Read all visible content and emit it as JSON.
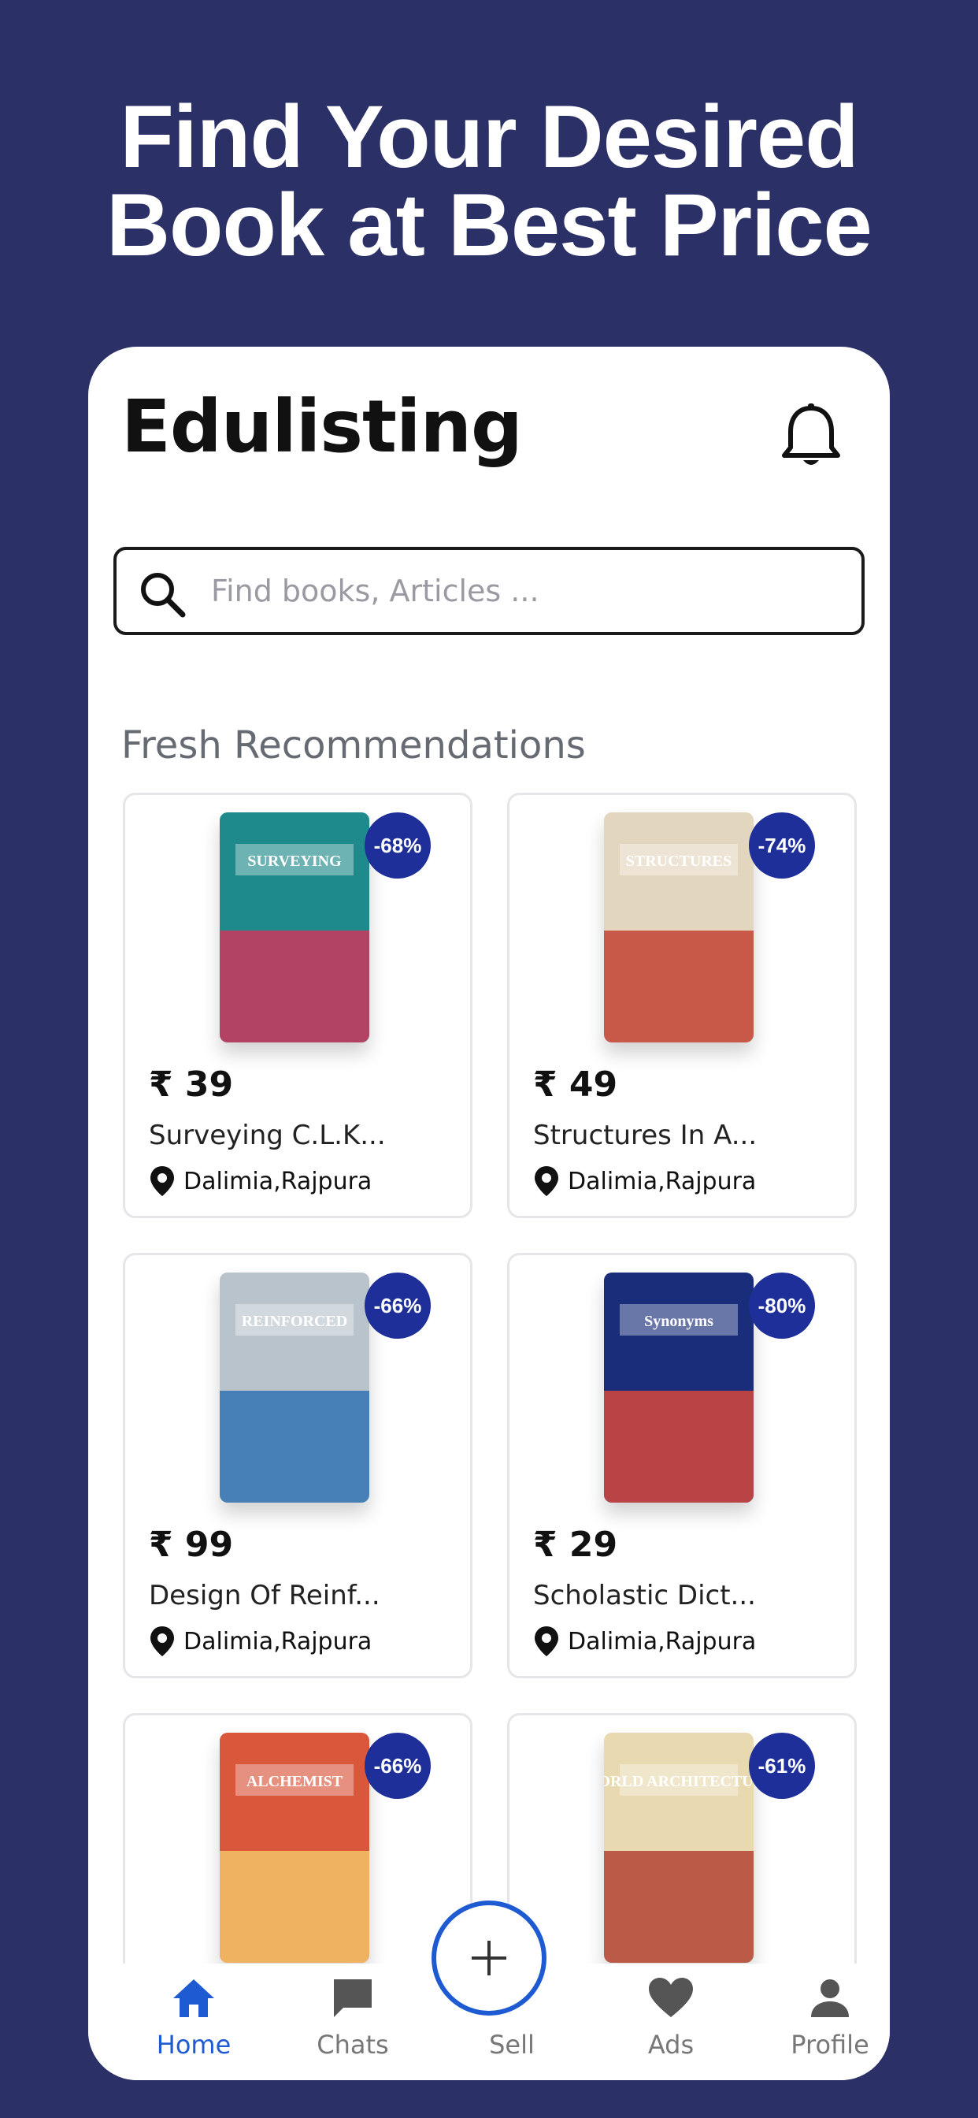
{
  "promo": {
    "line1": "Find Your Desired",
    "line2": "Book at Best Price"
  },
  "header": {
    "title": "Edulisting",
    "icon": "bell-icon"
  },
  "search": {
    "placeholder": "Find books, Articles ...",
    "value": "",
    "icon": "search-icon"
  },
  "section": {
    "title": "Fresh Recommendations"
  },
  "products": [
    {
      "discount": "-68%",
      "price": "₹ 39",
      "title": "Surveying C.L.K...",
      "location": "Dalimia,Rajpura",
      "cover_text": "SURVEYING",
      "cover_colors": [
        "#1f8a8c",
        "#d8315b"
      ]
    },
    {
      "discount": "-74%",
      "price": "₹ 49",
      "title": "Structures In A...",
      "location": "Dalimia,Rajpura",
      "cover_text": "STRUCTURES",
      "cover_colors": [
        "#e3d6bf",
        "#c0392b"
      ]
    },
    {
      "discount": "-66%",
      "price": "₹ 99",
      "title": "Design Of Reinf...",
      "location": "Dalimia,Rajpura",
      "cover_text": "REINFORCED",
      "cover_colors": [
        "#b9c3cc",
        "#2a6fb0"
      ]
    },
    {
      "discount": "-80%",
      "price": "₹ 29",
      "title": "Scholastic Dict...",
      "location": "Dalimia,Rajpura",
      "cover_text": "Synonyms",
      "cover_colors": [
        "#1a2d7a",
        "#e04a3a"
      ]
    },
    {
      "discount": "-66%",
      "price": "",
      "title": "",
      "location": "",
      "cover_text": "ALCHEMIST",
      "cover_colors": [
        "#d9573b",
        "#f2c96b"
      ]
    },
    {
      "discount": "-61%",
      "price": "",
      "title": "",
      "location": "",
      "cover_text": "WORLD ARCHITECTURE",
      "cover_colors": [
        "#e8d9b0",
        "#b03a2e"
      ]
    }
  ],
  "fab": {
    "label": "Sell",
    "icon": "plus-icon"
  },
  "nav": [
    {
      "label": "Home",
      "icon": "home-icon",
      "active": true
    },
    {
      "label": "Chats",
      "icon": "chat-icon",
      "active": false
    },
    {
      "label": "Sell",
      "icon": "plus-icon",
      "active": false
    },
    {
      "label": "Ads",
      "icon": "heart-icon",
      "active": false
    },
    {
      "label": "Profile",
      "icon": "person-icon",
      "active": false
    }
  ],
  "colors": {
    "background": "#2b3066",
    "accent": "#1e5ad2",
    "badge": "#1e2f9a"
  }
}
